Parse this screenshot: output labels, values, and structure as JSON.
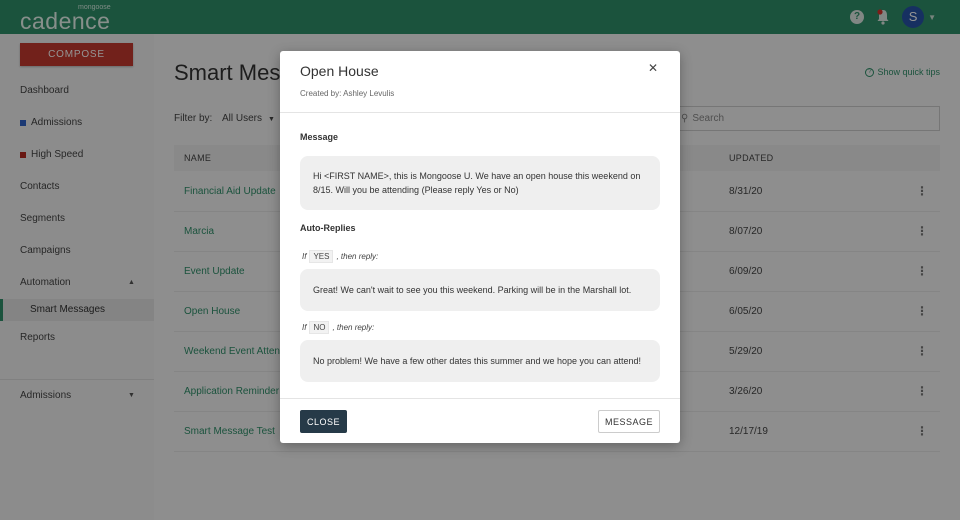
{
  "topbar": {
    "brand": "cadence",
    "brand_small": "mongoose",
    "avatar_letter": "S",
    "icons": [
      "help-icon",
      "bell-icon",
      "avatar",
      "caret-down-icon"
    ]
  },
  "sidebar": {
    "compose_label": "COMPOSE",
    "items": [
      {
        "label": "Dashboard"
      },
      {
        "label": "Admissions",
        "color": "#2f63c9"
      },
      {
        "label": "High Speed",
        "color": "#b52a22"
      },
      {
        "label": "Contacts"
      },
      {
        "label": "Segments"
      },
      {
        "label": "Campaigns"
      },
      {
        "label": "Automation"
      },
      {
        "label": "Smart Messages"
      },
      {
        "label": "Reports"
      },
      {
        "label": "Admissions"
      }
    ]
  },
  "main": {
    "title": "Smart Mess",
    "quick_tips": "Show quick tips",
    "filter_label": "Filter by:",
    "filter_value": "All Users",
    "search_placeholder": "Search",
    "columns": {
      "name": "NAME",
      "updated": "UPDATED"
    },
    "rows": [
      {
        "name": "Financial Aid Update",
        "updated": "8/31/20"
      },
      {
        "name": "Marcia",
        "updated": "8/07/20"
      },
      {
        "name": "Event Update",
        "updated": "6/09/20"
      },
      {
        "name": "Open House",
        "updated": "6/05/20"
      },
      {
        "name": "Weekend Event Attend",
        "updated": "5/29/20"
      },
      {
        "name": "Application Reminder",
        "updated": "3/26/20"
      },
      {
        "name": "Smart Message Test",
        "updated": "12/17/19"
      }
    ]
  },
  "modal": {
    "title": "Open House",
    "created_by": "Created by: Ashley Levulis",
    "message_label": "Message",
    "message_text": "Hi <FIRST NAME>, this is Mongoose U. We have an open house this weekend on 8/15. Will you be attending (Please reply Yes or No)",
    "auto_replies_label": "Auto-Replies",
    "replies": [
      {
        "if_word": "If",
        "keyword": "YES",
        "then": ", then reply:",
        "text": "Great! We can't wait to see you this weekend. Parking will be in the Marshall lot."
      },
      {
        "if_word": "If",
        "keyword": "NO",
        "then": ", then reply:",
        "text": "No problem! We have a few other dates this summer and we hope you can attend!"
      }
    ],
    "close_label": "CLOSE",
    "message_button_label": "MESSAGE"
  }
}
